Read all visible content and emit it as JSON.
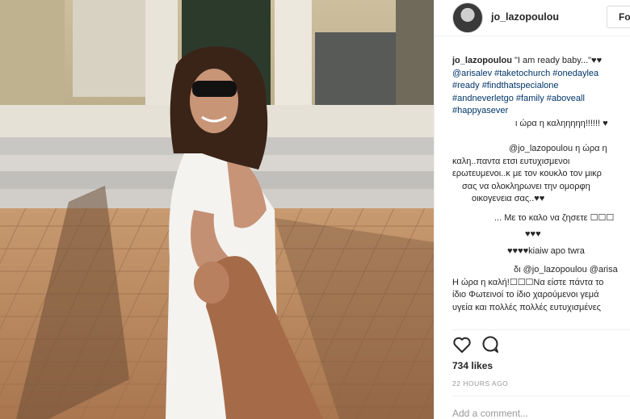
{
  "post": {
    "username": "jo_lazopoulou",
    "follow_label": "Follo",
    "caption": {
      "user": "jo_lazopoulou",
      "text": " \"I am ready baby...\"♥♥",
      "line2": "@arisalev #taketochurch #onedaylea",
      "line3": "#ready #findthatspecialone",
      "line4": "#andneverletgo #family #aboveall",
      "line5": "#happyasever"
    },
    "comments": [
      "ι ώρα η καληηηηη!!!!!! ♥",
      "@jo_lazopoulou η ώρα η",
      "καλη..παντα ετσι ευτυχισμενοι",
      "ερωτευμενοι..κ με τον κουκλο τον μικρ",
      "σας να ολοκληρωνει την ομορφη",
      "οικογενεια σας..♥♥",
      "... Με το καλο να ζησετε ☐☐☐",
      "♥♥♥",
      "♥♥♥♥kiaiw apo twra",
      "δι @jo_lazopoulou @arisa",
      "Η ώρα η καλή!☐☐☐Να είστε πάντα το",
      "ίδιο Φωτεινοί το ίδιο χαρούμενοι γεμά",
      "υγεία και πολλές πολλές ευτυχισμένες"
    ],
    "likes": "734 likes",
    "time_ago": "22 HOURS AGO",
    "add_comment_placeholder": "Add a comment..."
  },
  "icons": {
    "like": "heart-icon",
    "comment": "comment-bubble-icon"
  },
  "colors": {
    "text": "#262626",
    "hashtag": "#003569",
    "muted": "#999999",
    "divider": "#efefef"
  }
}
